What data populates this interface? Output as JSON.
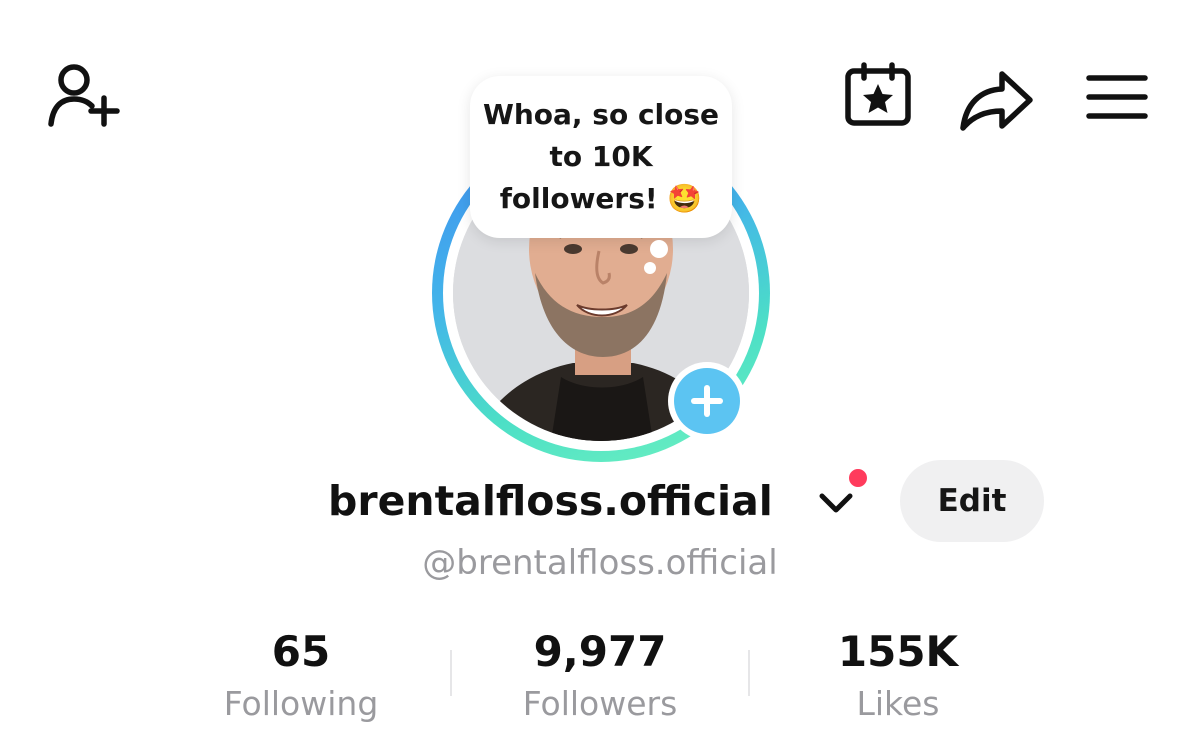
{
  "header": {
    "icons": {
      "add_friend": "add-user-icon",
      "calendar": "calendar-star-icon",
      "share": "share-arrow-icon",
      "menu": "hamburger-menu-icon"
    }
  },
  "bubble": {
    "text": "Whoa, so close to 10K followers! 🤩"
  },
  "profile": {
    "display_name": "brentalfloss.official",
    "username": "@brentalfloss.official",
    "edit_label": "Edit",
    "has_notification": true
  },
  "stats": [
    {
      "value": "65",
      "label": "Following"
    },
    {
      "value": "9,977",
      "label": "Followers"
    },
    {
      "value": "155K",
      "label": "Likes"
    }
  ],
  "colors": {
    "ring_start": "#3f8cf0",
    "ring_end": "#6ff2c0",
    "add_story": "#5cc4f2",
    "notification": "#ff3b5c",
    "muted_text": "#9a9a9e",
    "edit_bg": "#f0f0f1"
  }
}
